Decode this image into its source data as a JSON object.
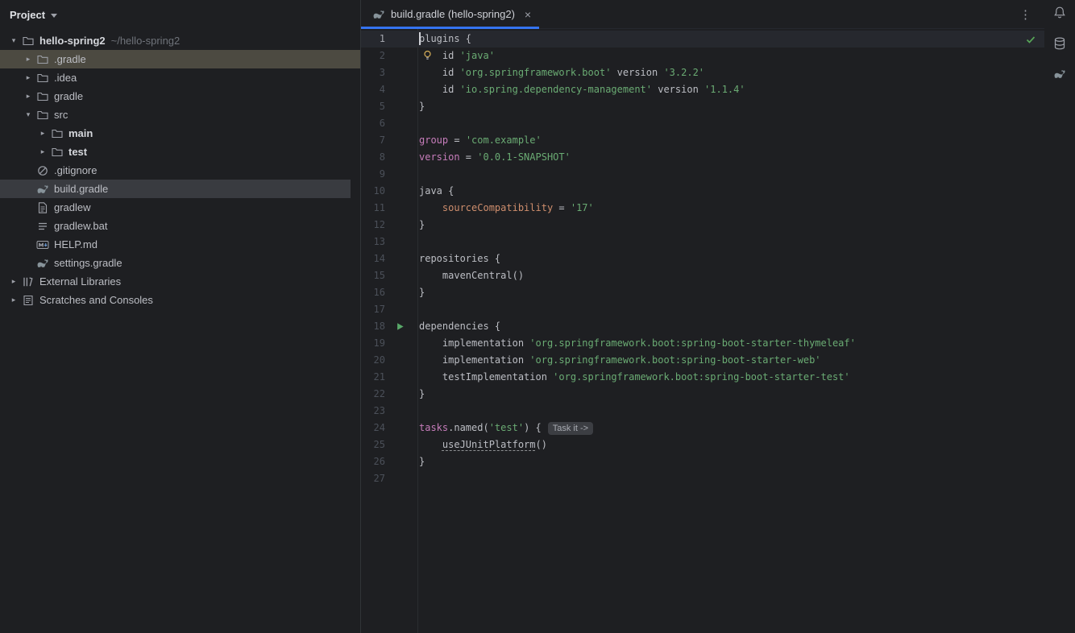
{
  "colors": {
    "accent": "#3574F0",
    "editor_bg": "#1E1F22",
    "string": "#6AAB73",
    "keyword": "#C77DBB",
    "property": "#CF8E6D",
    "selection_gray": "#393B40",
    "excluded_olive": "#4C4A41",
    "run_green": "#59A869",
    "check_green": "#57A558"
  },
  "project_panel": {
    "title": "Project",
    "tree": [
      {
        "label": "hello-spring2",
        "suffix": "~/hello-spring2",
        "icon": "folder",
        "chevron": "expanded",
        "bold": true,
        "indent": 0
      },
      {
        "label": ".gradle",
        "icon": "folder",
        "chevron": "collapsed",
        "indent": 1,
        "highlight": "olive"
      },
      {
        "label": ".idea",
        "icon": "folder",
        "chevron": "collapsed",
        "indent": 1
      },
      {
        "label": "gradle",
        "icon": "folder",
        "chevron": "collapsed",
        "indent": 1
      },
      {
        "label": "src",
        "icon": "folder",
        "chevron": "expanded",
        "indent": 1
      },
      {
        "label": "main",
        "icon": "folder-source",
        "chevron": "collapsed",
        "indent": 2,
        "bold": true
      },
      {
        "label": "test",
        "icon": "folder-test",
        "chevron": "collapsed",
        "indent": 2,
        "bold": true
      },
      {
        "label": ".gitignore",
        "icon": "ignore",
        "indent": 1
      },
      {
        "label": "build.gradle",
        "icon": "gradle",
        "indent": 1,
        "highlight": "selected"
      },
      {
        "label": "gradlew",
        "icon": "file",
        "indent": 1
      },
      {
        "label": "gradlew.bat",
        "icon": "file-lines",
        "indent": 1
      },
      {
        "label": "HELP.md",
        "icon": "markdown",
        "indent": 1
      },
      {
        "label": "settings.gradle",
        "icon": "gradle",
        "indent": 1
      },
      {
        "label": "External Libraries",
        "icon": "library",
        "chevron": "collapsed",
        "indent": 0
      },
      {
        "label": "Scratches and Consoles",
        "icon": "scratch",
        "chevron": "collapsed",
        "indent": 0
      }
    ]
  },
  "editor": {
    "tab": {
      "title": "build.gradle (hello-spring2)",
      "icon": "gradle"
    },
    "inspection_status": "ok",
    "lines": [
      {
        "n": 1,
        "current": true,
        "tokens": [
          [
            "plugins {",
            "d"
          ]
        ]
      },
      {
        "n": 2,
        "marker": "bulb",
        "tokens": [
          [
            "    id ",
            "d"
          ],
          [
            "'java'",
            "s"
          ]
        ]
      },
      {
        "n": 3,
        "tokens": [
          [
            "    id ",
            "d"
          ],
          [
            "'org.springframework.boot'",
            "s"
          ],
          [
            " version ",
            "d"
          ],
          [
            "'3.2.2'",
            "s"
          ]
        ]
      },
      {
        "n": 4,
        "tokens": [
          [
            "    id ",
            "d"
          ],
          [
            "'io.spring.dependency-management'",
            "s"
          ],
          [
            " version ",
            "d"
          ],
          [
            "'1.1.4'",
            "s"
          ]
        ]
      },
      {
        "n": 5,
        "tokens": [
          [
            "}",
            "d"
          ]
        ]
      },
      {
        "n": 6,
        "tokens": []
      },
      {
        "n": 7,
        "tokens": [
          [
            "group ",
            "k"
          ],
          [
            "= ",
            "d"
          ],
          [
            "'com.example'",
            "s"
          ]
        ]
      },
      {
        "n": 8,
        "tokens": [
          [
            "version ",
            "k"
          ],
          [
            "= ",
            "d"
          ],
          [
            "'0.0.1-SNAPSHOT'",
            "s"
          ]
        ]
      },
      {
        "n": 9,
        "tokens": []
      },
      {
        "n": 10,
        "tokens": [
          [
            "java {",
            "d"
          ]
        ]
      },
      {
        "n": 11,
        "tokens": [
          [
            "    ",
            "d"
          ],
          [
            "sourceCompatibility ",
            "p"
          ],
          [
            "= ",
            "d"
          ],
          [
            "'17'",
            "s"
          ]
        ]
      },
      {
        "n": 12,
        "tokens": [
          [
            "}",
            "d"
          ]
        ]
      },
      {
        "n": 13,
        "tokens": []
      },
      {
        "n": 14,
        "tokens": [
          [
            "repositories {",
            "d"
          ]
        ]
      },
      {
        "n": 15,
        "tokens": [
          [
            "    mavenCentral()",
            "d"
          ]
        ]
      },
      {
        "n": 16,
        "tokens": [
          [
            "}",
            "d"
          ]
        ]
      },
      {
        "n": 17,
        "tokens": []
      },
      {
        "n": 18,
        "marker": "run",
        "tokens": [
          [
            "dependencies {",
            "d"
          ]
        ]
      },
      {
        "n": 19,
        "tokens": [
          [
            "    implementation ",
            "d"
          ],
          [
            "'org.springframework.boot:spring-boot-starter-thymeleaf'",
            "s"
          ]
        ]
      },
      {
        "n": 20,
        "tokens": [
          [
            "    implementation ",
            "d"
          ],
          [
            "'org.springframework.boot:spring-boot-starter-web'",
            "s"
          ]
        ]
      },
      {
        "n": 21,
        "tokens": [
          [
            "    testImplementation ",
            "d"
          ],
          [
            "'org.springframework.boot:spring-boot-starter-test'",
            "s"
          ]
        ]
      },
      {
        "n": 22,
        "tokens": [
          [
            "}",
            "d"
          ]
        ]
      },
      {
        "n": 23,
        "tokens": []
      },
      {
        "n": 24,
        "inlay": "Task it ->",
        "tokens": [
          [
            "tasks",
            "k"
          ],
          [
            ".named(",
            "d"
          ],
          [
            "'test'",
            "s"
          ],
          [
            ") {",
            "d"
          ]
        ]
      },
      {
        "n": 25,
        "tokens": [
          [
            "    ",
            "d"
          ],
          [
            "useJUnitPlatform",
            "u"
          ],
          [
            "()",
            "d"
          ]
        ]
      },
      {
        "n": 26,
        "tokens": [
          [
            "}",
            "d"
          ]
        ]
      },
      {
        "n": 27,
        "tokens": []
      }
    ]
  },
  "right_stripe": {
    "icons": [
      {
        "name": "bell",
        "label": "notifications"
      },
      {
        "name": "database",
        "label": "database"
      },
      {
        "name": "gradle",
        "label": "gradle"
      }
    ]
  }
}
